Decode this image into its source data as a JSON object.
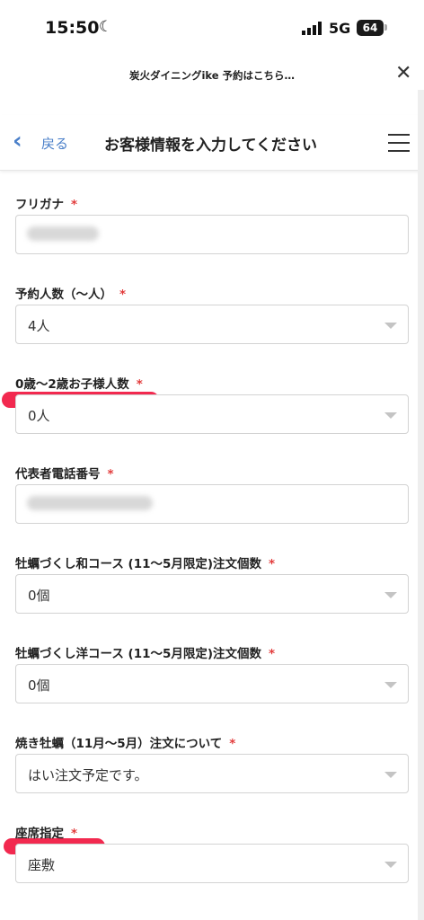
{
  "status": {
    "time": "15:50",
    "network": "5G",
    "battery": "64"
  },
  "browser": {
    "title": "炭火ダイニングike 予約はこちら…"
  },
  "header": {
    "back_label": "戻る",
    "title": "お客様情報を入力してください"
  },
  "form": {
    "required_mark": "*",
    "fields": [
      {
        "label": "フリガナ",
        "value": ""
      },
      {
        "label": "予約人数（〜人）",
        "value": "4人"
      },
      {
        "label": "0歳〜2歳お子様人数",
        "value": "0人"
      },
      {
        "label": "代表者電話番号",
        "value": ""
      },
      {
        "label": "牡蠣づくし和コース (11〜5月限定)注文個数",
        "value": "0個"
      },
      {
        "label": "牡蠣づくし洋コース (11〜5月限定)注文個数",
        "value": "0個"
      },
      {
        "label": "焼き牡蠣（11月〜5月）注文について",
        "value": "はい注文予定です。"
      },
      {
        "label": "座席指定",
        "value": "座敷"
      }
    ]
  },
  "colors": {
    "accent": "#4a7fc9",
    "required": "#e23b3b",
    "highlight": "#f2294f"
  }
}
